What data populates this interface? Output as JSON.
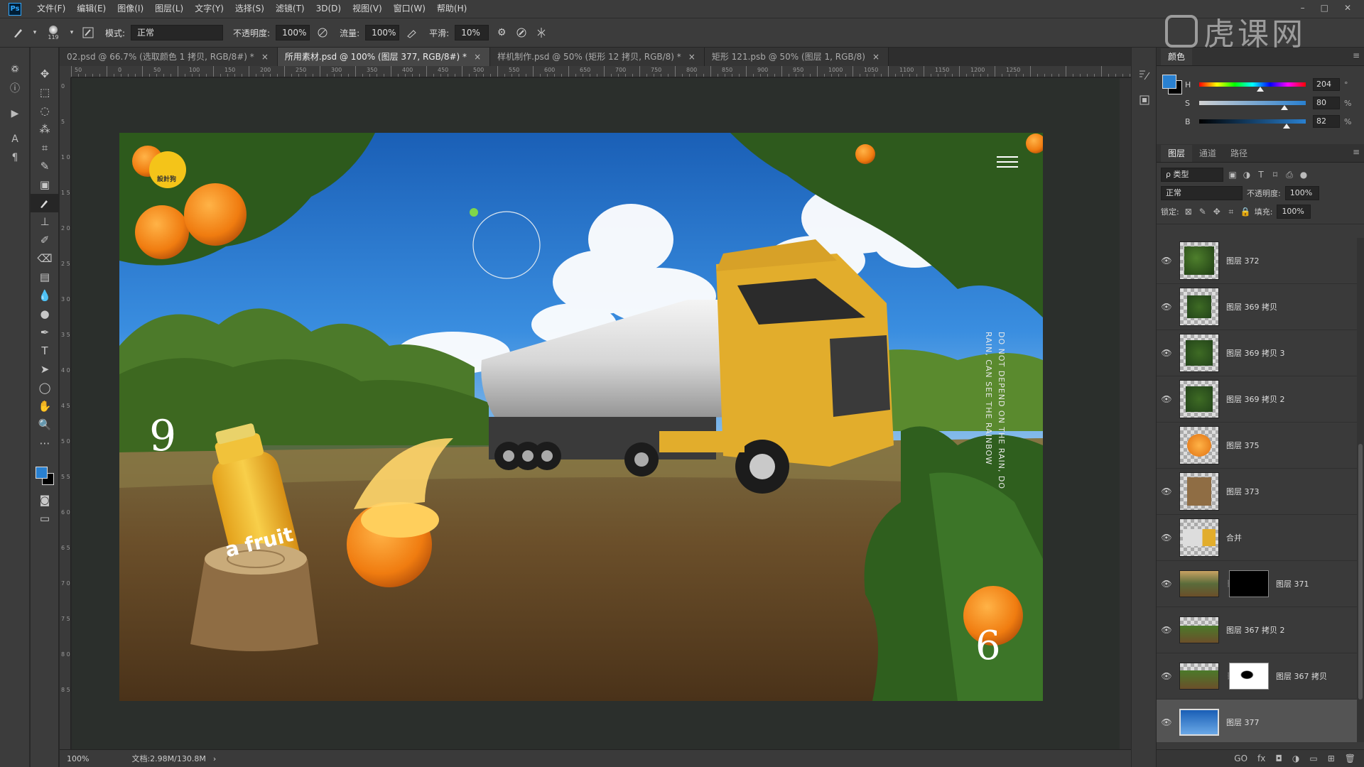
{
  "menubar": {
    "logo": "Ps",
    "items": [
      "文件(F)",
      "编辑(E)",
      "图像(I)",
      "图层(L)",
      "文字(Y)",
      "选择(S)",
      "滤镜(T)",
      "3D(D)",
      "视图(V)",
      "窗口(W)",
      "帮助(H)"
    ],
    "window_controls": [
      "–",
      "□",
      "✕"
    ]
  },
  "watermark": {
    "text": "虎课网"
  },
  "options_bar": {
    "brush_size": "119",
    "mode_label": "模式:",
    "mode_value": "正常",
    "opacity_label": "不透明度:",
    "opacity_value": "100%",
    "flow_label": "流量:",
    "flow_value": "100%",
    "smoothing_label": "平滑:",
    "smoothing_value": "10%"
  },
  "tabs": [
    {
      "label": "02.psd @ 66.7% (选取颜色 1 拷贝, RGB/8#) *",
      "active": false
    },
    {
      "label": "所用素材.psd @ 100% (图层 377, RGB/8#) *",
      "active": true
    },
    {
      "label": "样机制作.psd @ 50% (矩形 12 拷贝, RGB/8) *",
      "active": false
    },
    {
      "label": "矩形 121.psb @ 50% (图层 1, RGB/8)",
      "active": false
    }
  ],
  "tab_close": "×",
  "ruler_h": [
    "50",
    "0",
    "50",
    "100",
    "150",
    "200",
    "250",
    "300",
    "350",
    "400",
    "450",
    "500",
    "550",
    "600",
    "650",
    "700",
    "750",
    "800",
    "850",
    "900",
    "950",
    "1000",
    "1050",
    "1100",
    "1150",
    "1200",
    "1250"
  ],
  "ruler_v": [
    "0",
    "5",
    "1 0",
    "1 5",
    "2 0",
    "2 5",
    "3 0",
    "3 5",
    "4 0",
    "4 5",
    "5 0",
    "5 5",
    "6 0",
    "6 5",
    "7 0",
    "7 5",
    "8 0",
    "8 5"
  ],
  "canvas": {
    "logo_text": "設計狗",
    "num_left": "9",
    "num_right": "6",
    "bottle_text": "a fruit",
    "vertical_text_1": "DO NOT DEPEND ON THE RAIN, DO",
    "vertical_text_2": "RAIN, CAN SEE THE RAINBOW"
  },
  "status": {
    "zoom": "100%",
    "doc": "文档:2.98M/130.8M",
    "arrow": "›"
  },
  "color_panel": {
    "tab": "颜色",
    "h_label": "H",
    "h_value": "204",
    "h_unit": "°",
    "s_label": "S",
    "s_value": "80",
    "s_unit": "%",
    "b_label": "B",
    "b_value": "82",
    "b_unit": "%",
    "fg_color": "#2980d0",
    "bg_color": "#000000"
  },
  "layers_panel": {
    "tabs": [
      "图层",
      "通道",
      "路径"
    ],
    "filter_label": "ρ 类型",
    "blend_mode": "正常",
    "opacity_label": "不透明度:",
    "opacity_value": "100%",
    "lock_label": "锁定:",
    "fill_label": "填充:",
    "fill_value": "100%",
    "layers": [
      {
        "name": "图层 372",
        "visible": true,
        "thumb": "tree"
      },
      {
        "name": "图层 369 拷贝",
        "visible": true,
        "thumb": "tree"
      },
      {
        "name": "图层 369 拷贝 3",
        "visible": true,
        "thumb": "tree"
      },
      {
        "name": "图层 369 拷贝 2",
        "visible": true,
        "thumb": "tree"
      },
      {
        "name": "图层 375",
        "visible": false,
        "thumb": "orange"
      },
      {
        "name": "图层 373",
        "visible": true,
        "thumb": "stump"
      },
      {
        "name": "合并",
        "visible": true,
        "thumb": "truck"
      },
      {
        "name": "图层 371",
        "visible": true,
        "thumb": "landscape",
        "mask": "black"
      },
      {
        "name": "图层 367 拷贝 2",
        "visible": true,
        "thumb": "field"
      },
      {
        "name": "图层 367 拷贝",
        "visible": true,
        "thumb": "field",
        "mask": "white"
      },
      {
        "name": "图层 377",
        "visible": true,
        "thumb": "sky",
        "selected": true
      }
    ],
    "footer_icons": [
      "GO",
      "fx",
      "◘",
      "◑",
      "▭",
      "⊞",
      "🗑"
    ]
  },
  "colors": {
    "accent": "#31a8ff",
    "sky_top": "#1a5fb6",
    "truck_yellow": "#e2ad2c"
  }
}
